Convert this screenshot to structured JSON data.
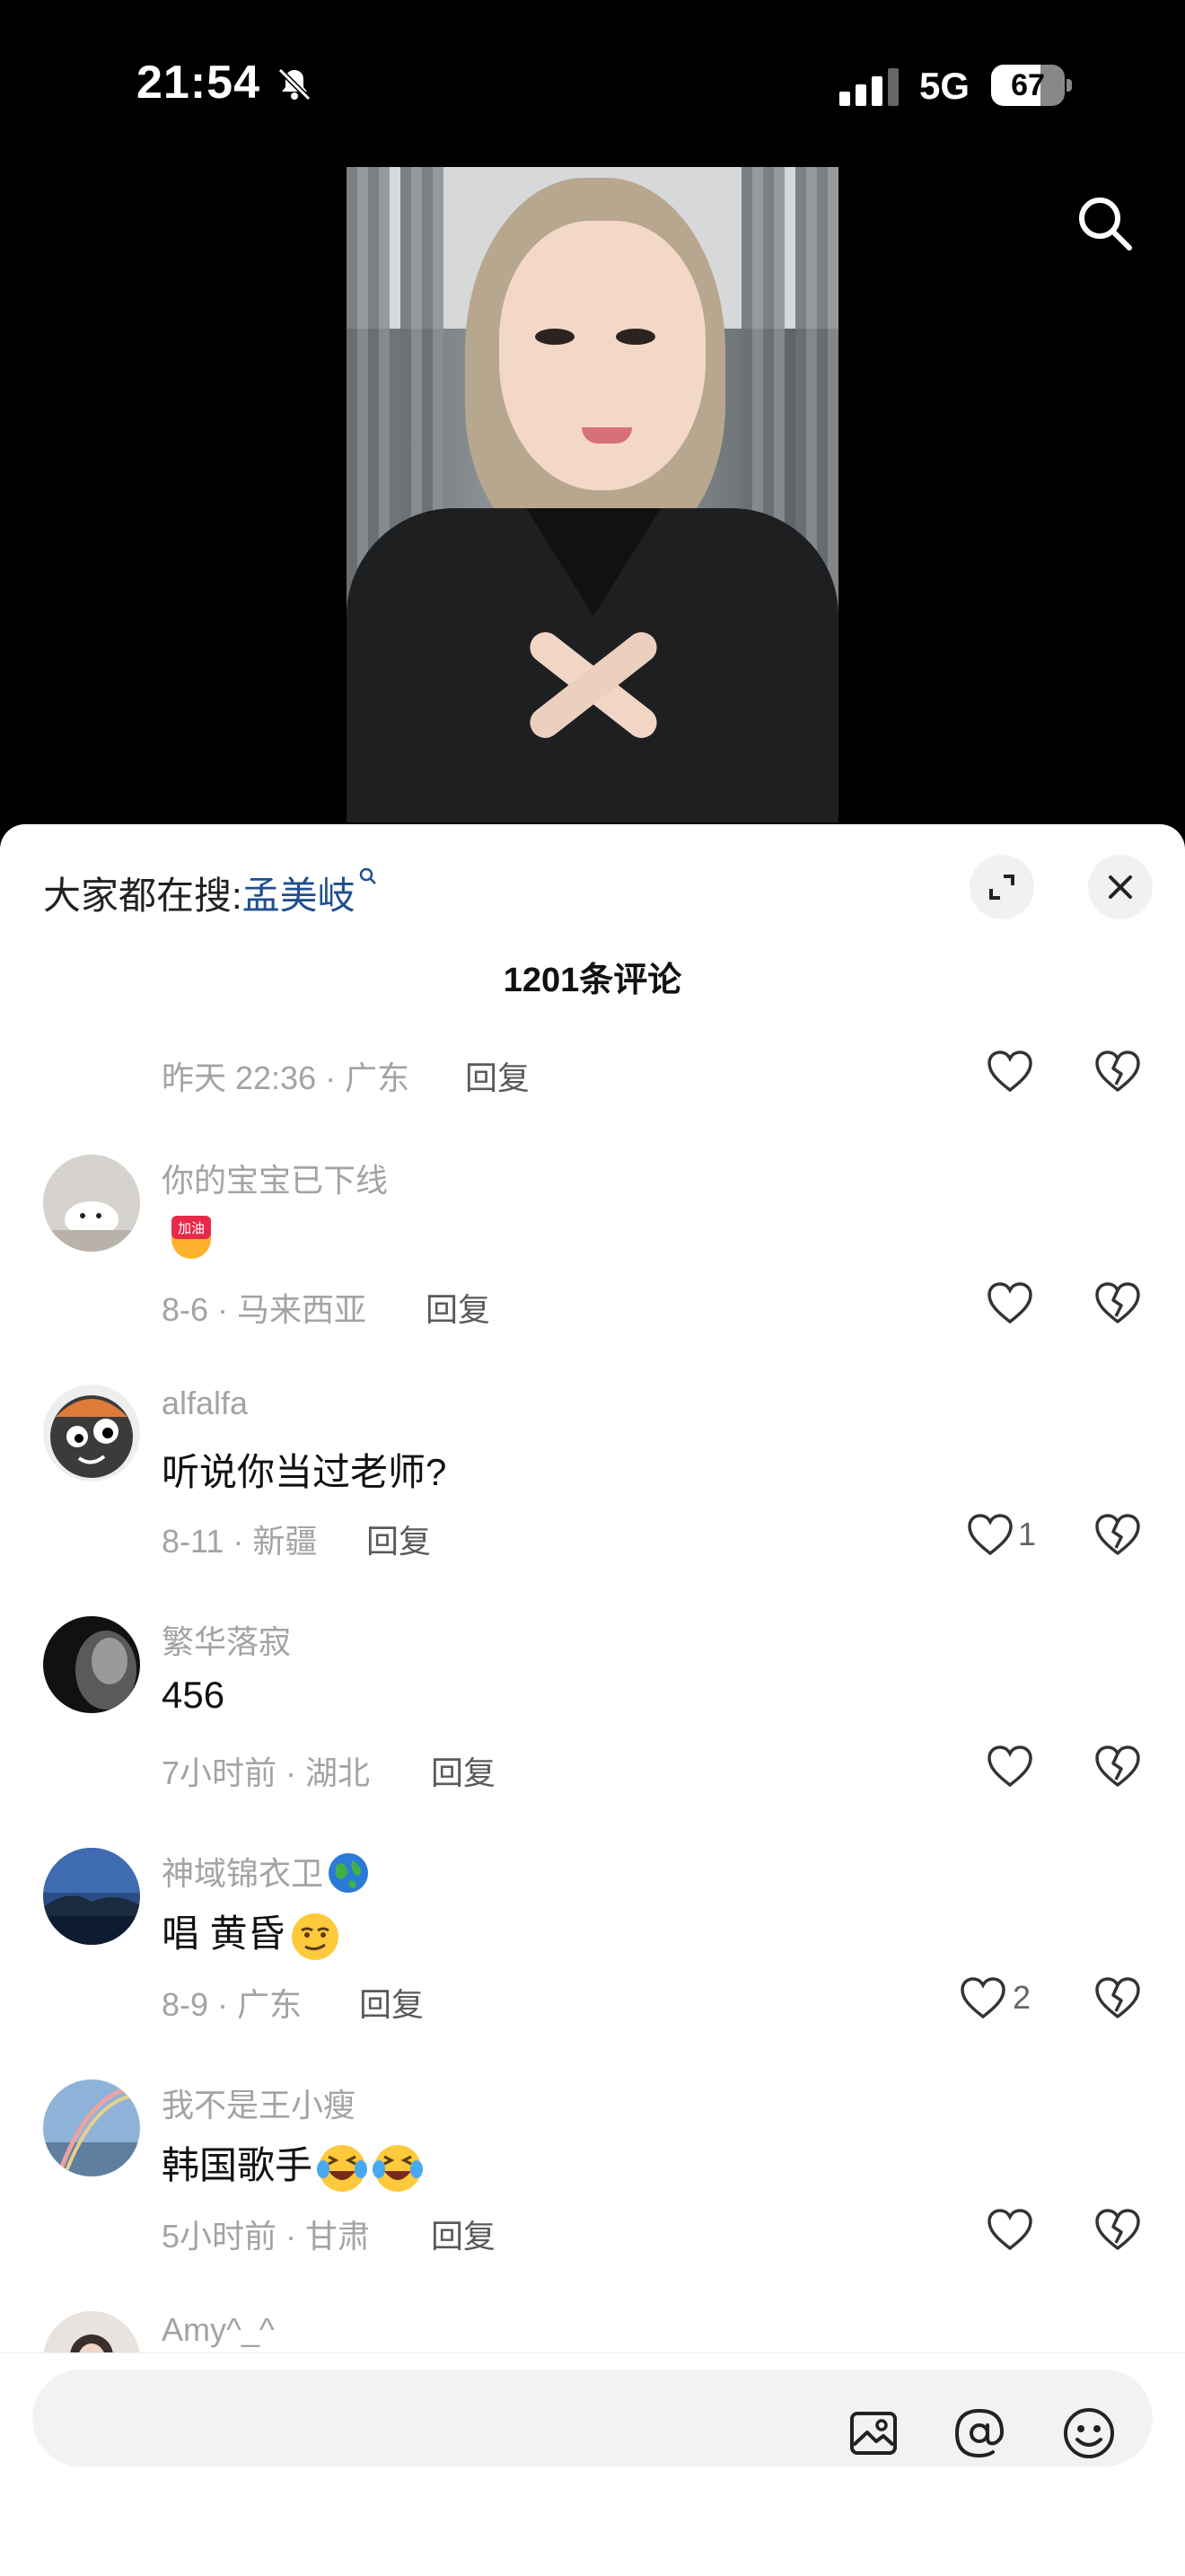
{
  "status_bar": {
    "time": "21:54",
    "network": "5G",
    "battery": "67",
    "battery_level": 0.67
  },
  "sheet": {
    "trending_prefix": "大家都在搜:",
    "trending_keyword": "孟美岐",
    "comment_count": "1201条评论"
  },
  "comments": [
    {
      "username": "",
      "text": "",
      "meta": "昨天 22:36 · 广东",
      "reply": "回复",
      "likes": ""
    },
    {
      "username": "你的宝宝已下线",
      "text": "",
      "emojis": [
        "加油"
      ],
      "meta": "8-6 · 马来西亚",
      "reply": "回复",
      "likes": ""
    },
    {
      "username": "alfalfa",
      "text": "听说你当过老师?",
      "meta": "8-11 · 新疆",
      "reply": "回复",
      "likes": "1"
    },
    {
      "username": "繁华落寂",
      "text": "456",
      "meta": "7小时前 · 湖北",
      "reply": "回复",
      "likes": ""
    },
    {
      "username": "神域锦衣卫",
      "text": "唱 黄昏",
      "meta": "8-9 · 广东",
      "reply": "回复",
      "likes": "2"
    },
    {
      "username": "我不是王小瘦",
      "text": "韩国歌手",
      "meta": "5小时前 · 甘肃",
      "reply": "回复",
      "likes": ""
    },
    {
      "username": "Amy^_^",
      "text": "",
      "meta": "",
      "reply": "",
      "likes": ""
    }
  ],
  "input": {
    "placeholder": ""
  },
  "icons": {
    "search": "search-icon",
    "expand": "expand-icon",
    "close": "close-icon",
    "like": "heart-icon",
    "dislike": "broken-heart-icon",
    "image": "image-icon",
    "mention": "at-icon",
    "emoji": "emoji-icon"
  }
}
